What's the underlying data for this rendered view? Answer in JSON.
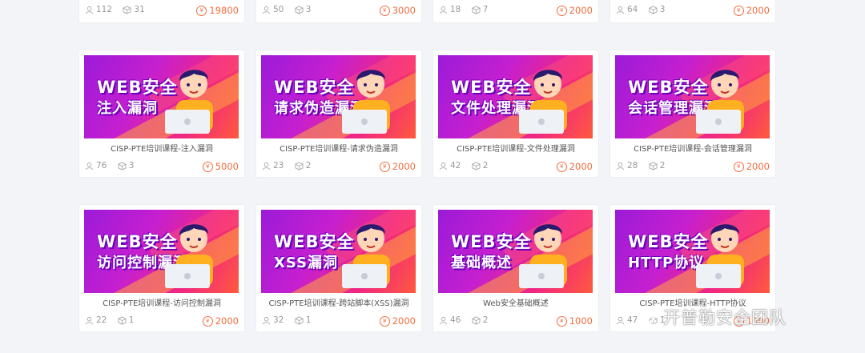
{
  "price_symbol": "¥",
  "accent_color": "#f36c3e",
  "top_row": [
    {
      "learners": "112",
      "lessons": "31",
      "price": "19800"
    },
    {
      "learners": "50",
      "lessons": "3",
      "price": "3000"
    },
    {
      "learners": "18",
      "lessons": "7",
      "price": "2000"
    },
    {
      "learners": "64",
      "lessons": "3",
      "price": "2000"
    }
  ],
  "courses": [
    {
      "banner_line1": "WEB安全",
      "banner_line2": "注入漏洞",
      "title": "CISP-PTE培训课程-注入漏洞",
      "learners": "76",
      "lessons": "3",
      "price": "5000"
    },
    {
      "banner_line1": "WEB安全",
      "banner_line2": "请求伪造漏洞",
      "title": "CISP-PTE培训课程-请求伪造漏洞",
      "learners": "23",
      "lessons": "2",
      "price": "2000"
    },
    {
      "banner_line1": "WEB安全",
      "banner_line2": "文件处理漏洞",
      "title": "CISP-PTE培训课程-文件处理漏洞",
      "learners": "42",
      "lessons": "2",
      "price": "2000"
    },
    {
      "banner_line1": "WEB安全",
      "banner_line2": "会话管理漏洞",
      "title": "CISP-PTE培训课程-会话管理漏洞",
      "learners": "28",
      "lessons": "2",
      "price": "2000"
    },
    {
      "banner_line1": "WEB安全",
      "banner_line2": "访问控制漏洞",
      "title": "CISP-PTE培训课程-访问控制漏洞",
      "learners": "22",
      "lessons": "1",
      "price": "2000"
    },
    {
      "banner_line1": "WEB安全",
      "banner_line2": "XSS漏洞",
      "title": "CISP-PTE培训课程-跨站脚本(XSS)漏洞",
      "learners": "32",
      "lessons": "1",
      "price": "2000"
    },
    {
      "banner_line1": "WEB安全",
      "banner_line2": "基础概述",
      "title": "Web安全基础概述",
      "learners": "46",
      "lessons": "2",
      "price": "1000"
    },
    {
      "banner_line1": "WEB安全",
      "banner_line2": "HTTP协议",
      "title": "CISP-PTE培训课程-HTTP协议",
      "learners": "47",
      "lessons": "1",
      "price": "1000"
    }
  ],
  "watermark": {
    "text": "开普勒安全团队",
    "icon": "wechat-icon"
  }
}
